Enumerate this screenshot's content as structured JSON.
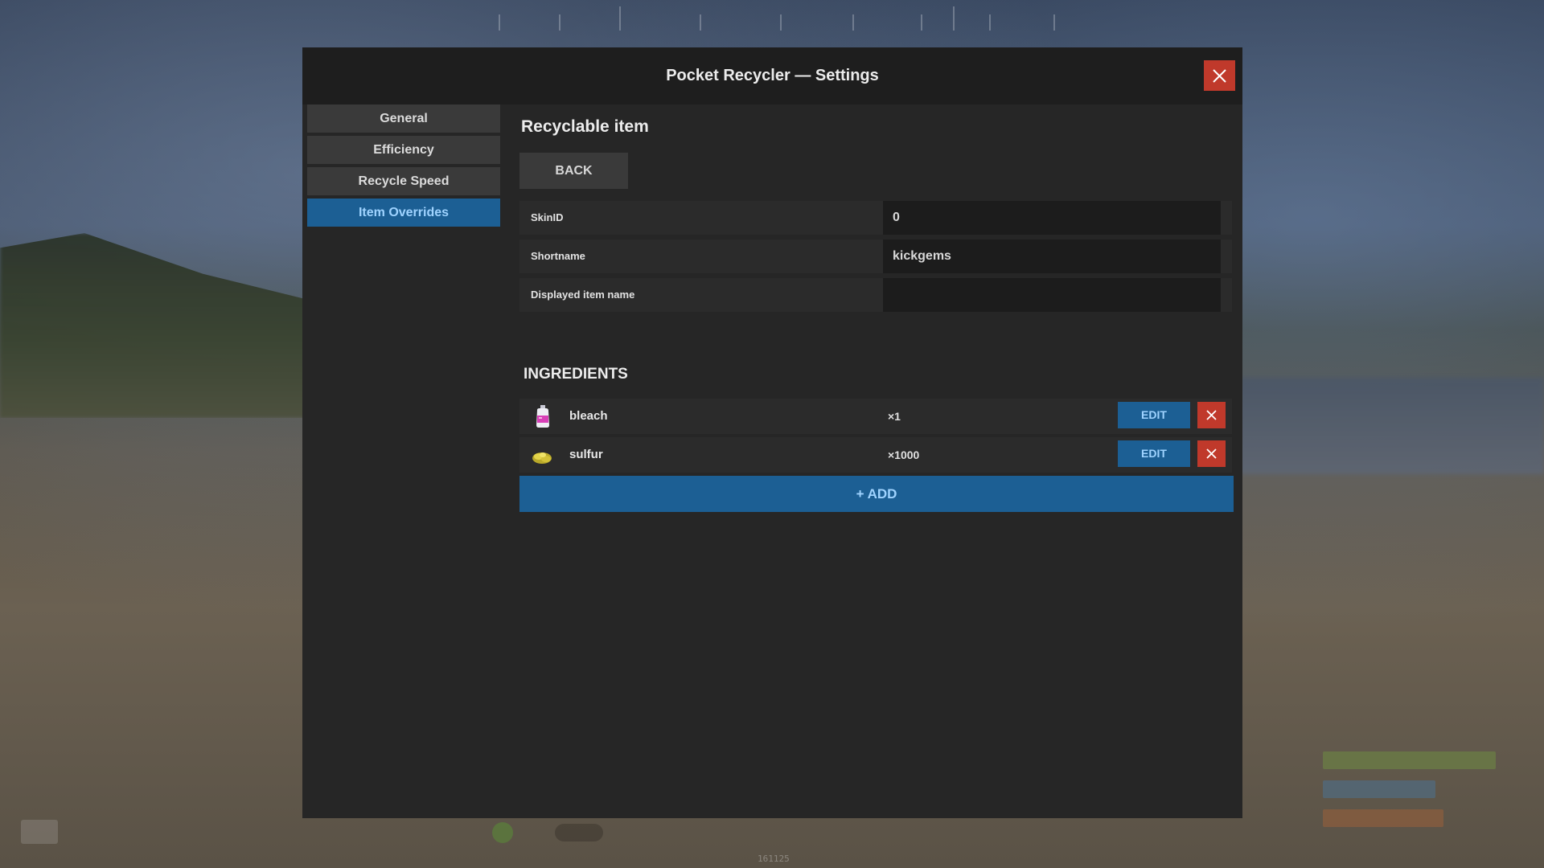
{
  "modal": {
    "title": "Pocket Recycler — Settings"
  },
  "sidebar": {
    "items": [
      {
        "label": "General",
        "active": false
      },
      {
        "label": "Efficiency",
        "active": false
      },
      {
        "label": "Recycle Speed",
        "active": false
      },
      {
        "label": "Item Overrides",
        "active": true
      }
    ]
  },
  "content": {
    "title": "Recyclable item",
    "back_label": "BACK",
    "fields": [
      {
        "label": "SkinID",
        "value": "0"
      },
      {
        "label": "Shortname",
        "value": "kickgems"
      },
      {
        "label": "Displayed item name",
        "value": ""
      }
    ],
    "ingredients_title": "INGREDIENTS",
    "ingredients": [
      {
        "name": "bleach",
        "quantity": "×1",
        "icon": "bleach-bottle-icon",
        "edit_label": "EDIT"
      },
      {
        "name": "sulfur",
        "quantity": "×1000",
        "icon": "sulfur-ore-icon",
        "edit_label": "EDIT"
      }
    ],
    "add_label": "+ ADD"
  },
  "hud": {
    "bottom_text": "161125"
  },
  "colors": {
    "accent_blue": "#1c5f94",
    "accent_text": "#9fd3ff",
    "danger_red": "#c0392b",
    "panel_bg": "#262626",
    "header_bg": "#1e1e1e"
  }
}
